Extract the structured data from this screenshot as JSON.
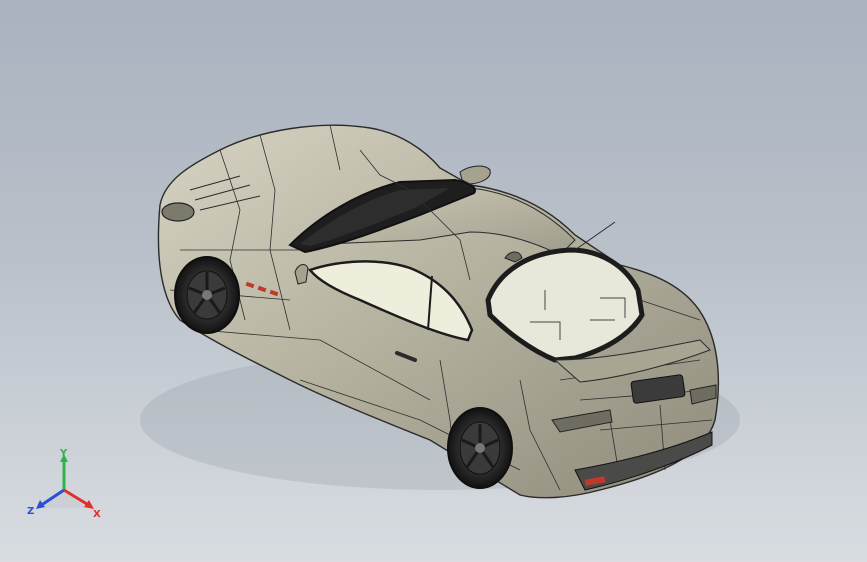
{
  "viewport": {
    "background_top": "#a9b2bf",
    "background_bottom": "#d9dde2"
  },
  "model": {
    "body_color": "#b8b5a2",
    "edge_color": "#2b2b2b",
    "glass_color": "#1c1c1c",
    "window_light": "#efeedd",
    "wheel_color": "#2a2a2a",
    "accent_color": "#c0392b"
  },
  "triad": {
    "x_label": "X",
    "y_label": "Y",
    "z_label": "Z",
    "x_color": "#e0302a",
    "y_color": "#2fb34a",
    "z_color": "#2a4fd6"
  }
}
